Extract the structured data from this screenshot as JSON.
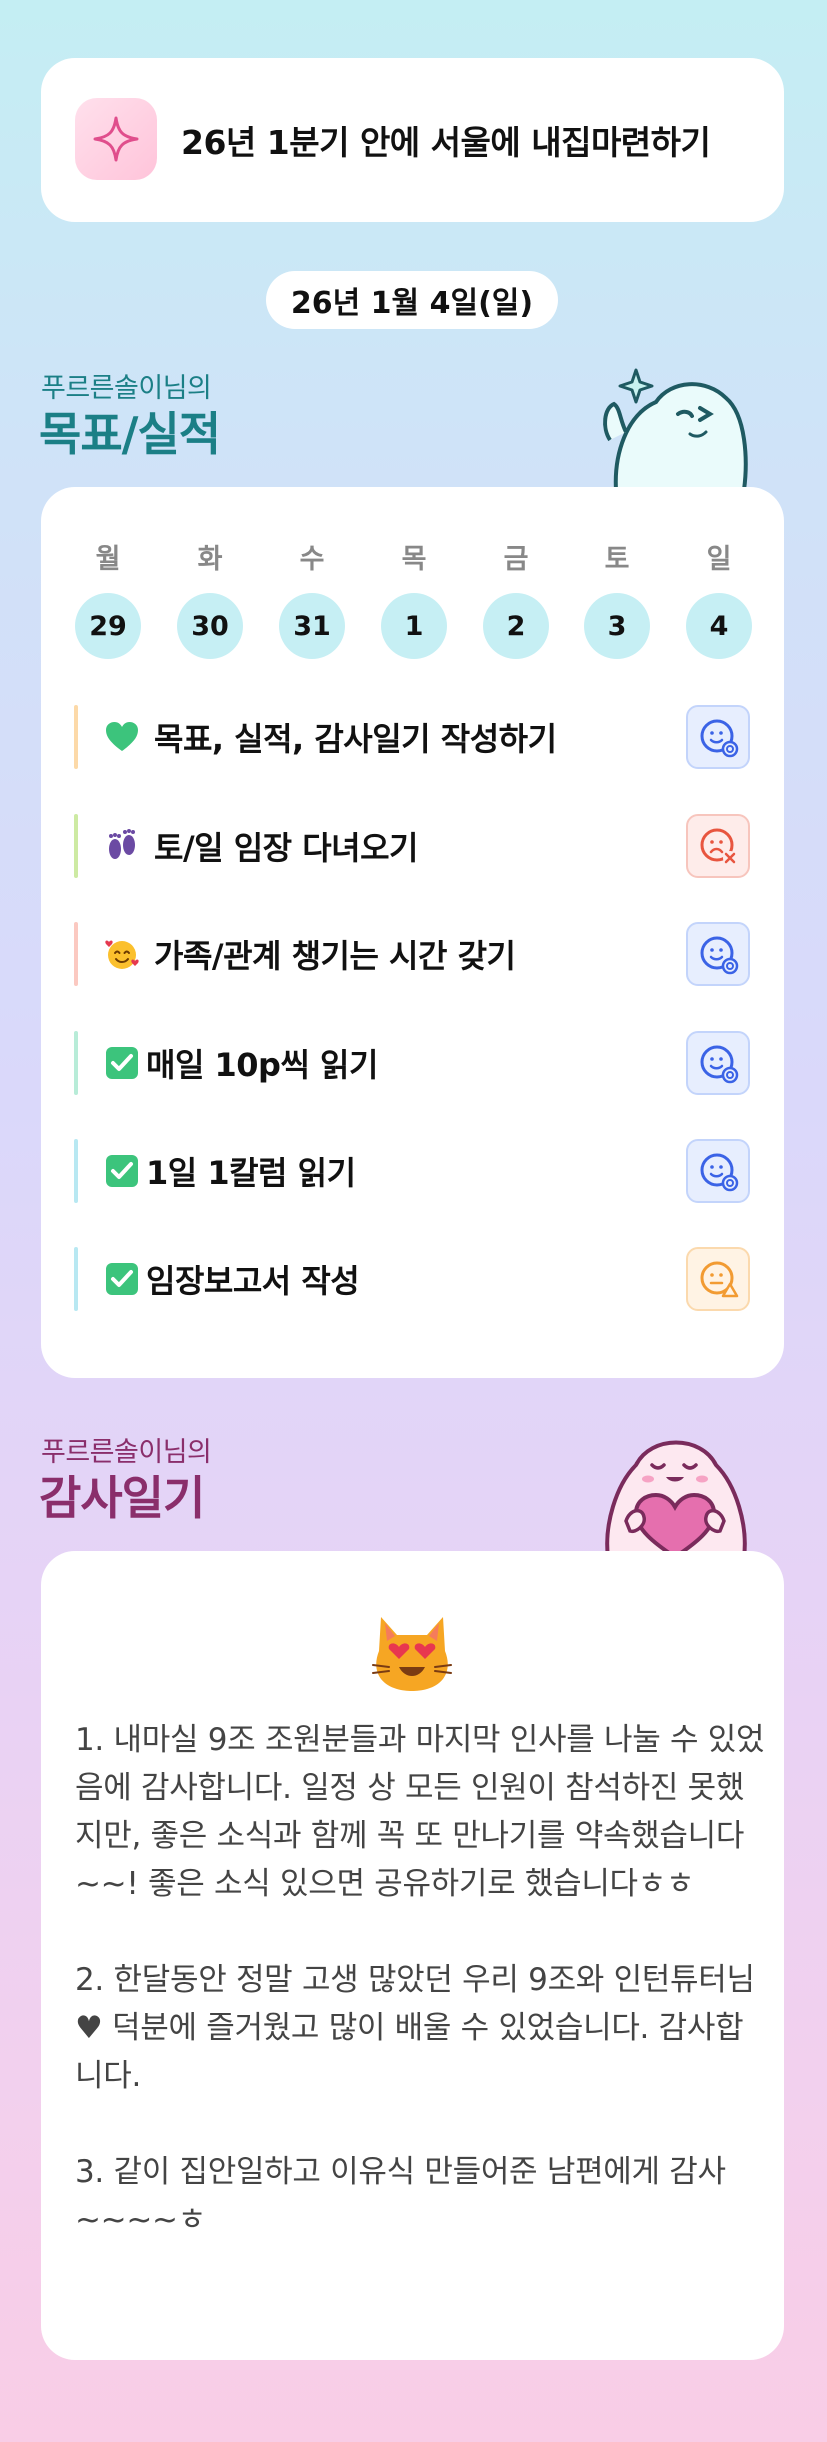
{
  "goal": {
    "text": "26년 1분기 안에 서울에 내집마련하기",
    "icon": "sparkle-icon"
  },
  "date": "26년 1월 4일(일)",
  "goals_section": {
    "owner": "푸르른솔이님의",
    "title": "목표/실적"
  },
  "week": [
    {
      "day": "월",
      "date": "29"
    },
    {
      "day": "화",
      "date": "30"
    },
    {
      "day": "수",
      "date": "31"
    },
    {
      "day": "목",
      "date": "1"
    },
    {
      "day": "금",
      "date": "2"
    },
    {
      "day": "토",
      "date": "3"
    },
    {
      "day": "일",
      "date": "4"
    }
  ],
  "tasks": [
    {
      "emoji": "green-heart-icon",
      "label": "목표, 실적, 감사일기 작성하기",
      "status": "done",
      "bar": "#fcd9a8"
    },
    {
      "emoji": "footprints-icon",
      "label": "토/일 임장 다녀오기",
      "status": "failed",
      "bar": "#cdeaa3"
    },
    {
      "emoji": "smiling-face-hearts-icon",
      "label": "가족/관계 챙기는 시간 갖기",
      "status": "done",
      "bar": "#fbc9c1"
    },
    {
      "emoji": "check-mark-icon",
      "label": "매일 10p씩 읽기",
      "status": "done",
      "bar": "#b8ecd8"
    },
    {
      "emoji": "check-mark-icon",
      "label": "1일 1칼럼 읽기",
      "status": "done",
      "bar": "#b8e8f2"
    },
    {
      "emoji": "check-mark-icon",
      "label": "임장보고서 작성",
      "status": "partial",
      "bar": "#b8e8f2"
    }
  ],
  "status_colors": {
    "done": "#3b63e6",
    "failed": "#e8553f",
    "partial": "#f29b32"
  },
  "gratitude_section": {
    "owner": "푸르른솔이님의",
    "title": "감사일기"
  },
  "gratitude": {
    "emoji": "heart-eyes-cat-icon",
    "body": "1. 내마실 9조 조원분들과 마지막 인사를 나눌 수 있었음에 감사합니다. 일정 상 모든 인원이 참석하진 못했지만, 좋은 소식과 함께 꼭 또 만나기를 약속했습니다~~! 좋은 소식 있으면 공유하기로 했습니다ㅎㅎ\n\n2. 한달동안 정말 고생 많았던 우리 9조와 인턴튜터님♥ 덕분에 즐거웠고 많이 배울 수 있었습니다. 감사합니다.\n\n3. 같이 집안일하고 이유식 만들어준 남편에게 감사~~~~ㅎ"
  }
}
